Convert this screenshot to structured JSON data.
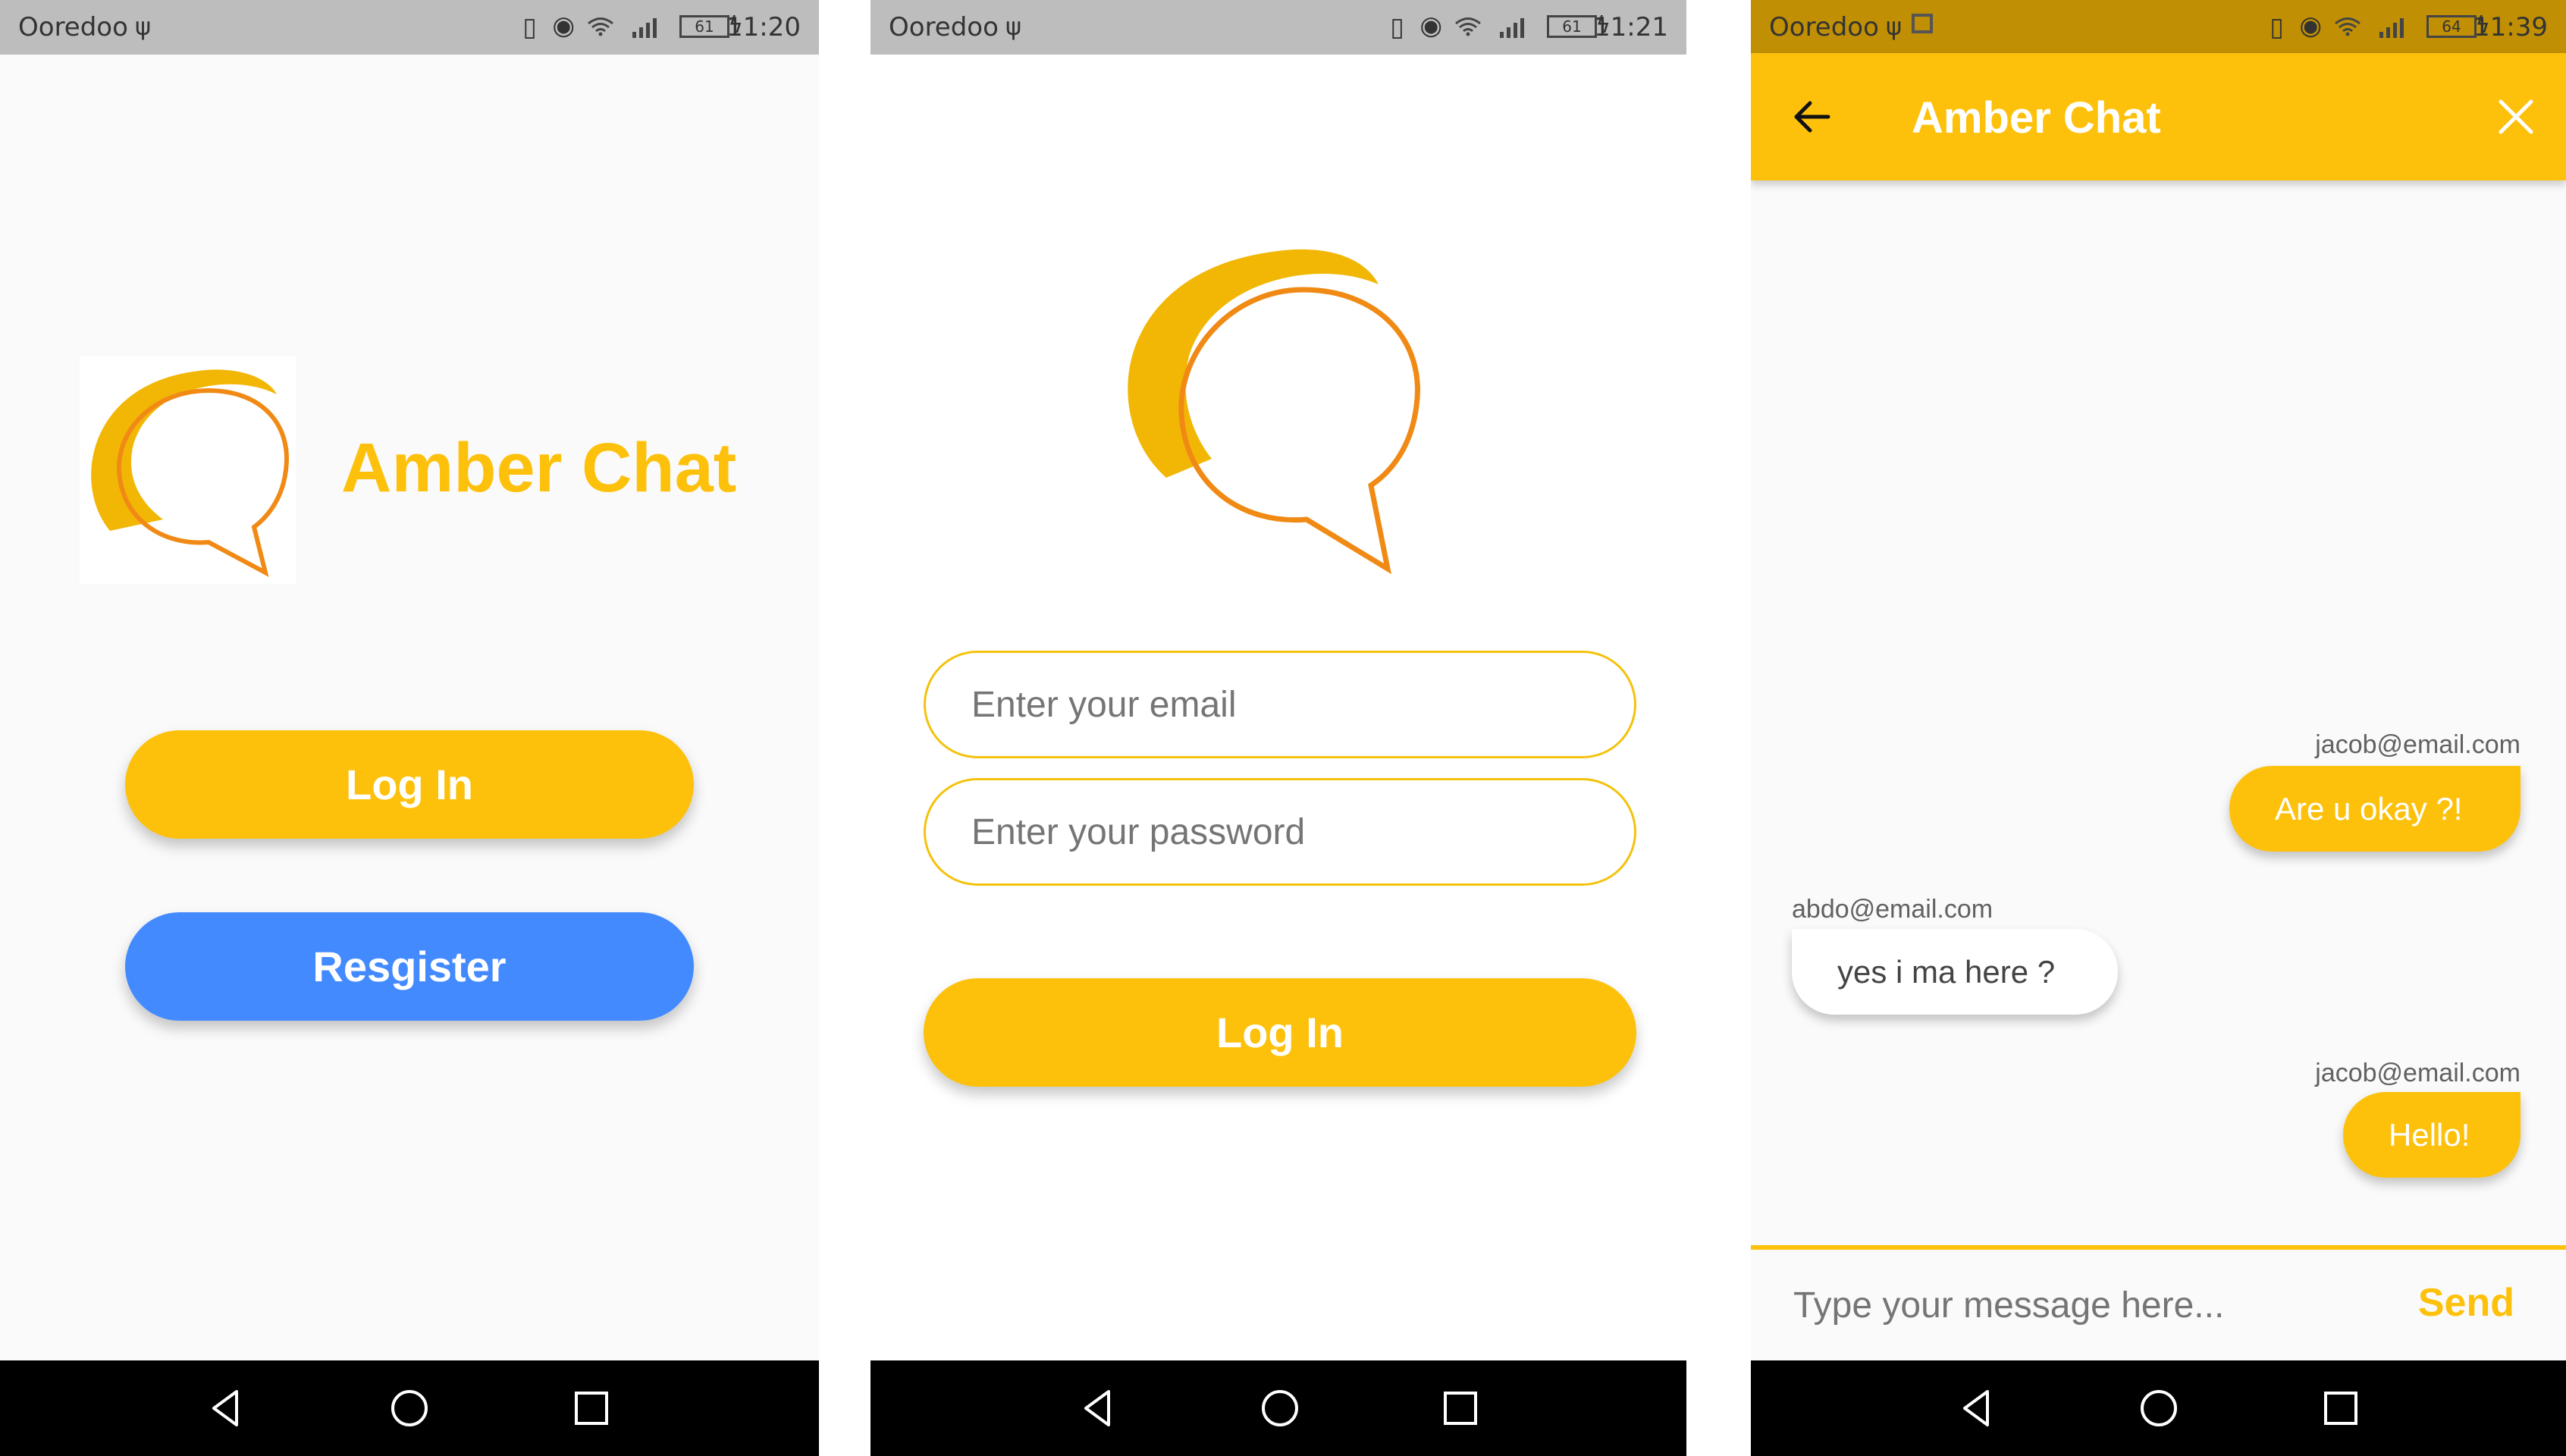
{
  "colors": {
    "amber": "#fdc10c",
    "blue": "#448aff",
    "logo_orange": "#f08a15",
    "logo_gold": "#f2b705"
  },
  "screens": [
    {
      "status": {
        "carrier": "Ooredoo",
        "battery": "61",
        "time": "11:20"
      },
      "logo": {
        "title": "Amber Chat"
      },
      "buttons": {
        "login": "Log In",
        "register": "Resgister"
      }
    },
    {
      "status": {
        "carrier": "Ooredoo",
        "battery": "61",
        "time": "11:21"
      },
      "form": {
        "email_placeholder": "Enter your email",
        "password_placeholder": "Enter your password",
        "login": "Log In"
      }
    },
    {
      "status": {
        "carrier": "Ooredoo",
        "battery": "64",
        "time": "11:39"
      },
      "appbar": {
        "title": "Amber Chat",
        "back_icon": "arrow-left-icon",
        "close_icon": "close-icon"
      },
      "messages": [
        {
          "sender": "jacob@email.com",
          "text": "Are u okay ?!",
          "is_me": true
        },
        {
          "sender": "abdo@email.com",
          "text": "yes i ma here ?",
          "is_me": false
        },
        {
          "sender": "jacob@email.com",
          "text": "Hello!",
          "is_me": true
        }
      ],
      "compose": {
        "placeholder": "Type your message here...",
        "send": "Send"
      }
    }
  ]
}
